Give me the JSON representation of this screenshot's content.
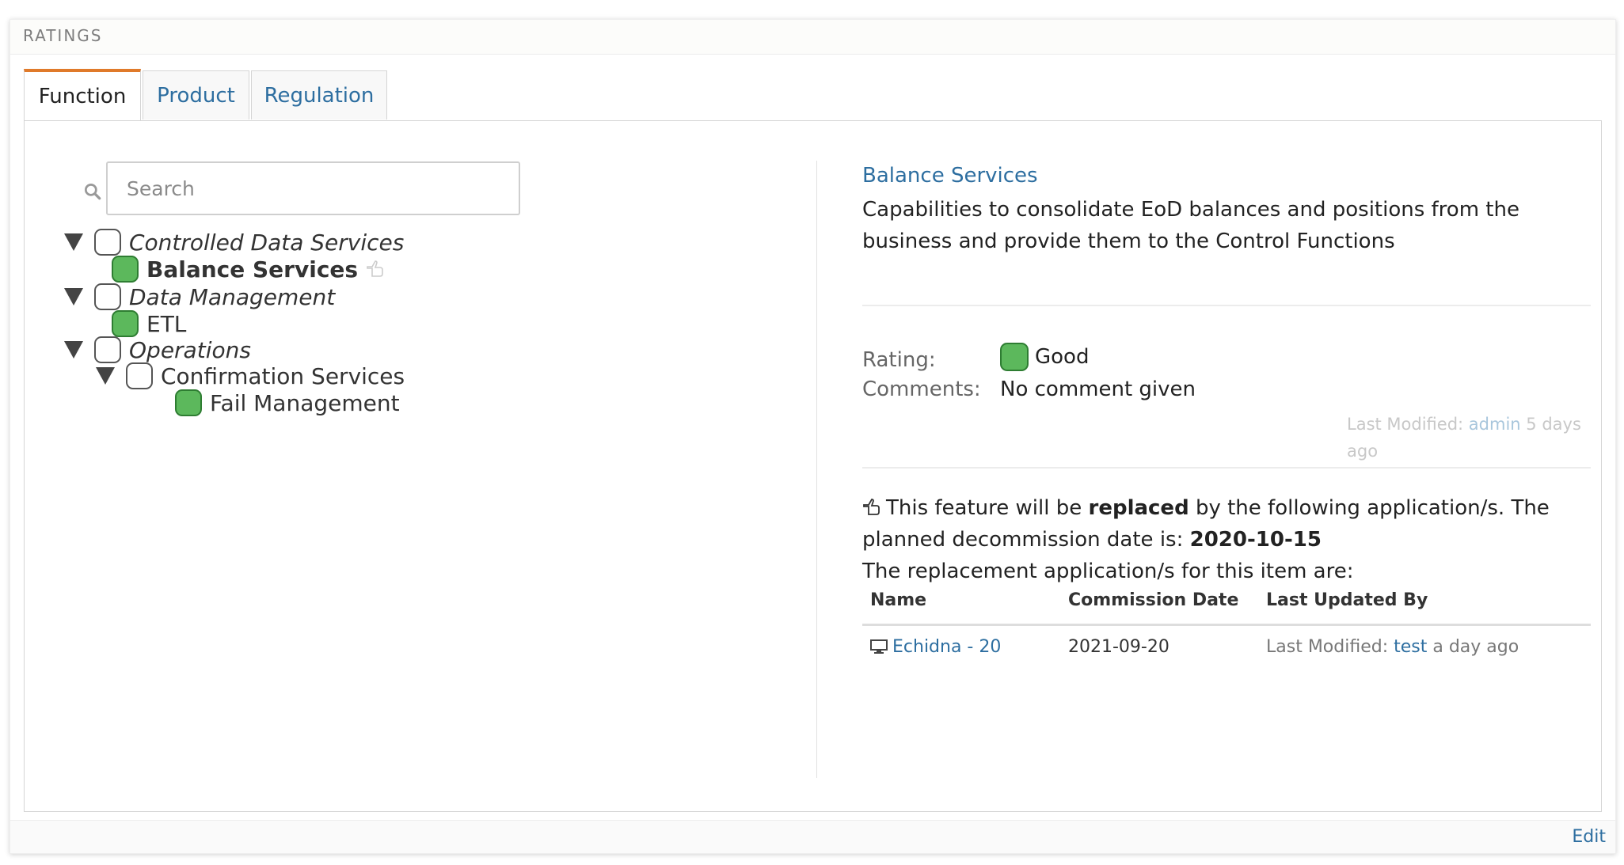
{
  "panel": {
    "title": "RATINGS"
  },
  "tabs": [
    {
      "label": "Function",
      "active": true
    },
    {
      "label": "Product",
      "active": false
    },
    {
      "label": "Regulation",
      "active": false
    }
  ],
  "search": {
    "placeholder": "Search",
    "value": ""
  },
  "tree": {
    "controlled_data_services": "Controlled Data Services",
    "balance_services": "Balance Services",
    "data_management": "Data Management",
    "etl": "ETL",
    "operations": "Operations",
    "confirmation_services": "Confirmation Services",
    "fail_management": "Fail Management"
  },
  "detail": {
    "title": "Balance Services",
    "description": "Capabilities to consolidate EoD balances and positions from the business and provide them to the Control Functions",
    "rating_label": "Rating:",
    "rating_value": "Good",
    "comments_label": "Comments:",
    "comments_value": "No comment given",
    "last_modified_prefix": "Last Modified:",
    "last_modified_user": "admin",
    "last_modified_when": "5 days ago"
  },
  "replacement": {
    "text_1": "This feature will be",
    "text_replaced": "replaced",
    "text_2": "by the following application/s. The planned decommission date is:",
    "decommission_date": "2020-10-15",
    "text_3": "The replacement application/s for this item are:",
    "columns": [
      "Name",
      "Commission Date",
      "Last Updated By"
    ],
    "rows": [
      {
        "name": "Echidna - 20",
        "commission_date": "2021-09-20",
        "last_mod_prefix": "Last Modified:",
        "last_mod_user": "test",
        "last_mod_when": "a day ago"
      }
    ]
  },
  "footer": {
    "edit_label": "Edit"
  },
  "colors": {
    "accent": "#e07a2a",
    "link": "#2d6ea0",
    "good": "#5cb85c"
  }
}
